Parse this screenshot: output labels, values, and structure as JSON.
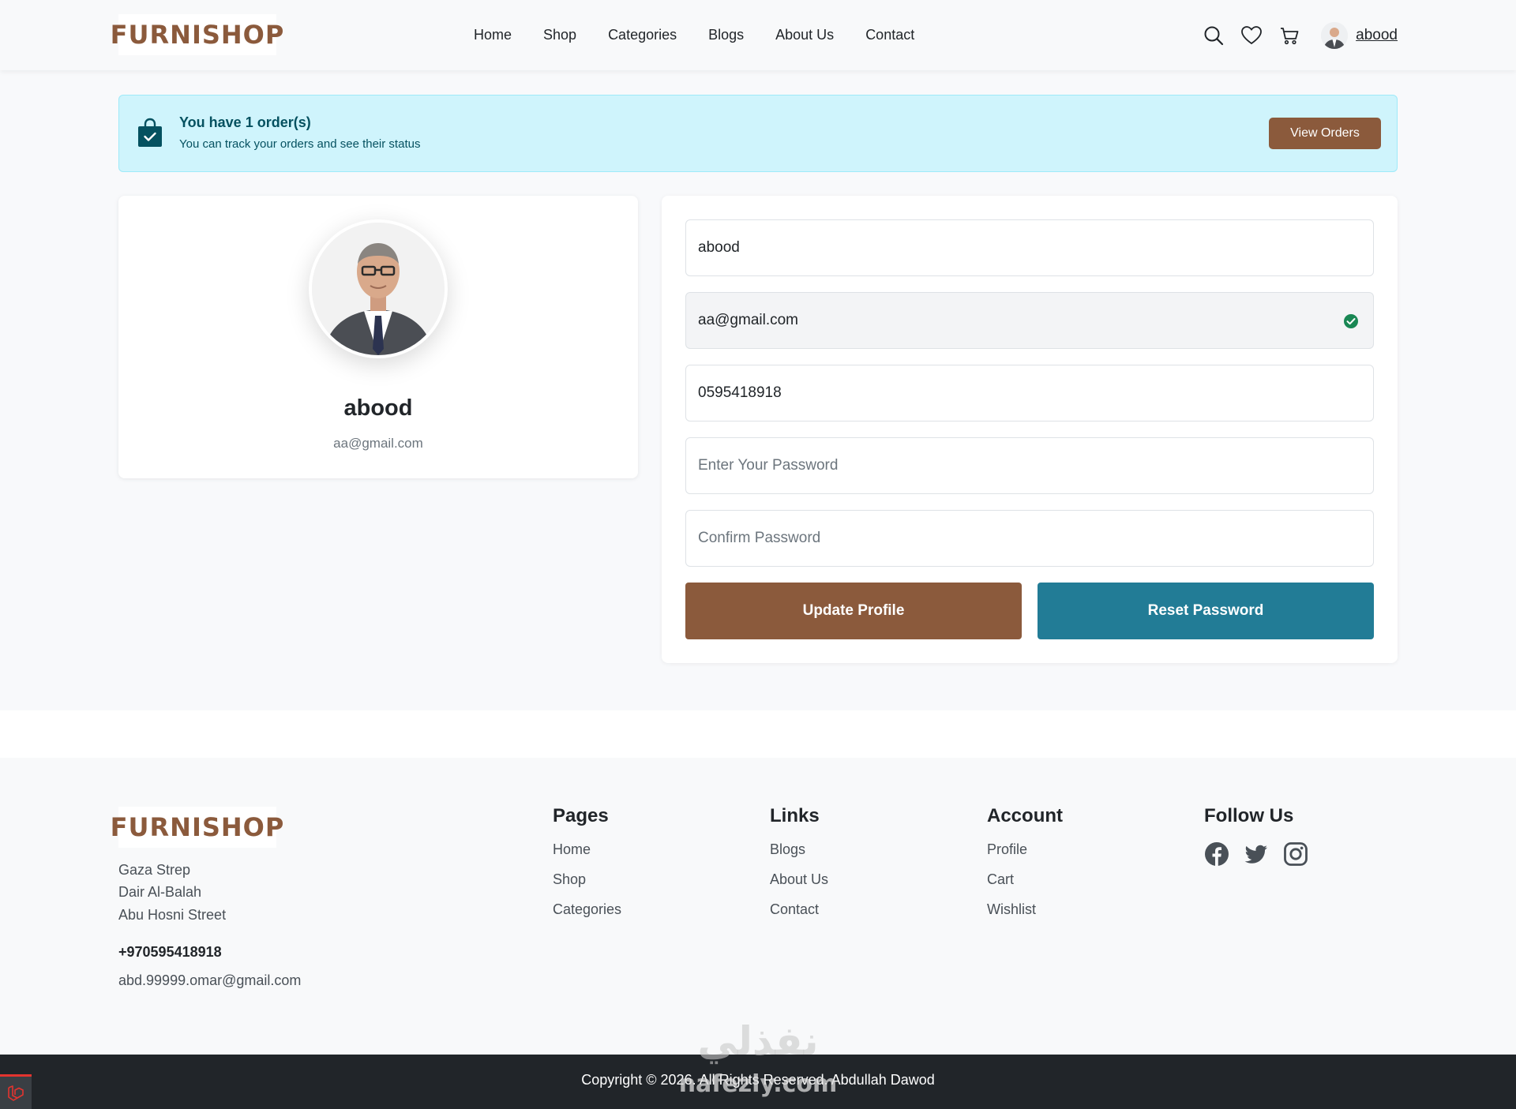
{
  "brand": {
    "logo_text": "FURNISHOP",
    "logo_color": "#8b5a3c",
    "accent": "#8b5a3c",
    "secondary": "#227c96"
  },
  "nav": {
    "items": [
      "Home",
      "Shop",
      "Categories",
      "Blogs",
      "About Us",
      "Contact"
    ]
  },
  "header": {
    "user_name": "abood",
    "icons": [
      "search-icon",
      "heart-icon",
      "cart-icon",
      "avatar"
    ]
  },
  "alert": {
    "title": "You have 1 order(s)",
    "subtitle": "You can track your orders and see their status",
    "button_label": "View Orders",
    "icon": "shopping-bag-check-icon"
  },
  "profile": {
    "name": "abood",
    "email": "aa@gmail.com"
  },
  "form": {
    "name_value": "abood",
    "email_value": "aa@gmail.com",
    "phone_value": "0595418918",
    "password_placeholder": "Enter Your Password",
    "confirm_placeholder": "Confirm Password",
    "update_label": "Update Profile",
    "reset_label": "Reset Password"
  },
  "footer": {
    "logo_text": "FURNISHOP",
    "address_lines": [
      "Gaza Strep",
      "Dair Al-Balah",
      "Abu Hosni Street"
    ],
    "phone": "+970595418918",
    "email": "abd.99999.omar@gmail.com",
    "columns": [
      {
        "title": "Pages",
        "links": [
          "Home",
          "Shop",
          "Categories"
        ]
      },
      {
        "title": "Links",
        "links": [
          "Blogs",
          "About Us",
          "Contact"
        ]
      },
      {
        "title": "Account",
        "links": [
          "Profile",
          "Cart",
          "Wishlist"
        ]
      }
    ],
    "follow_title": "Follow Us",
    "socials": [
      "facebook-icon",
      "twitter-icon",
      "instagram-icon"
    ],
    "copyright": "Copyright © 2026. All Rights Reserved. Abdullah Dawod"
  },
  "watermark": {
    "arabic": "نفذلي",
    "latin": "nafezly.com"
  }
}
